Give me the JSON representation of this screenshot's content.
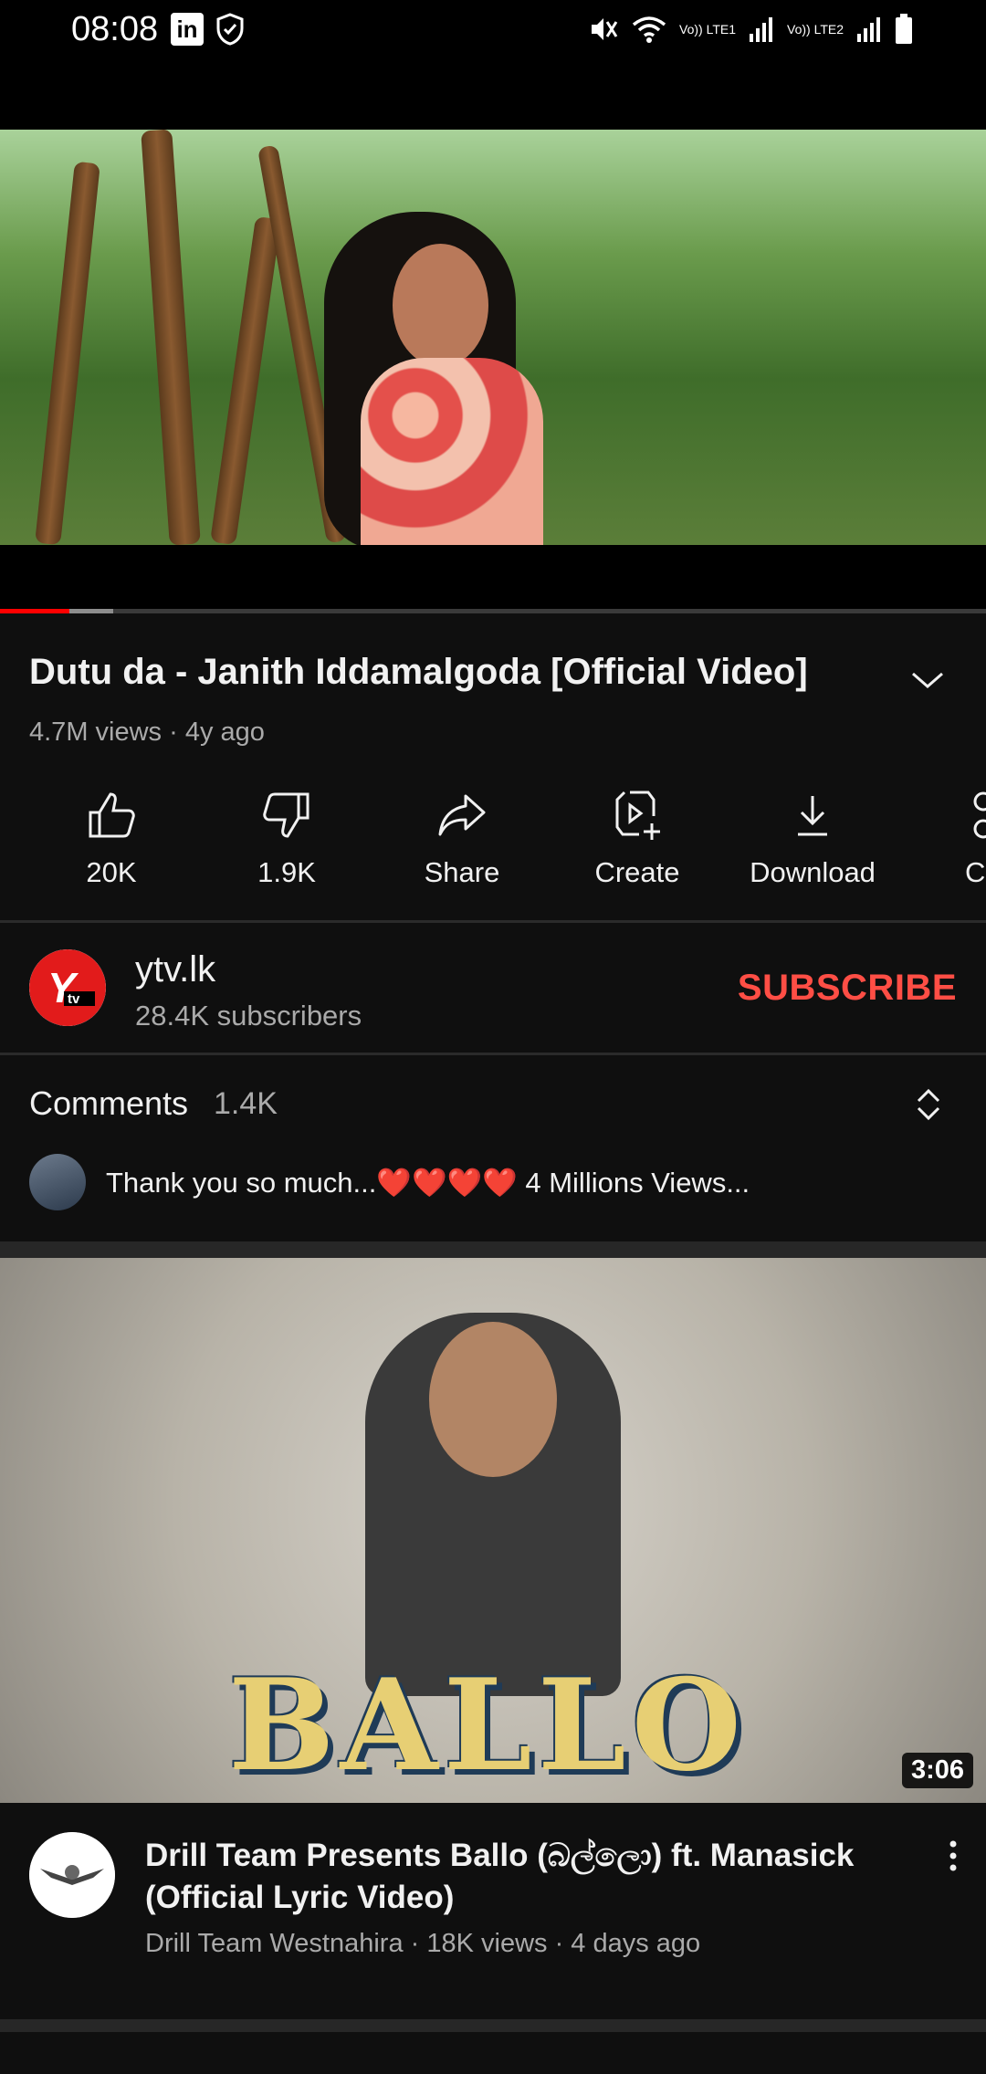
{
  "status_bar": {
    "time": "08:08",
    "left_icons": [
      "linkedin-icon",
      "shield-icon"
    ],
    "right_icons": [
      "mute-icon",
      "wifi-icon",
      "signal-icon",
      "battery-icon"
    ],
    "sim1": "Vo)) LTE1",
    "sim2": "Vo)) LTE2"
  },
  "player": {
    "progress_played": 0.07,
    "progress_buffered": 0.115
  },
  "video": {
    "title": "Dutu da - Janith Iddamalgoda [Official Video]",
    "meta": "4.7M views · 4y ago"
  },
  "actions": [
    {
      "label": "20K",
      "icon": "like-icon"
    },
    {
      "label": "1.9K",
      "icon": "dislike-icon"
    },
    {
      "label": "Share",
      "icon": "share-icon"
    },
    {
      "label": "Create",
      "icon": "create-icon"
    },
    {
      "label": "Download",
      "icon": "download-icon"
    },
    {
      "label": "Cl",
      "icon": "clip-icon"
    }
  ],
  "channel": {
    "name": "ytv.lk",
    "subscribers": "28.4K subscribers",
    "subscribe_label": "SUBSCRIBE",
    "avatar_text": "Ytv"
  },
  "comments": {
    "title": "Comments",
    "count": "1.4K",
    "top_comment": "Thank you so much...❤️❤️❤️❤️ 4 Millions Views..."
  },
  "recommended": {
    "thumb_text": "BALLO",
    "duration": "3:06",
    "title": "Drill Team Presents Ballo (බල්ලො) ft. Manasick (Official Lyric Video)",
    "meta": "Drill Team Westnahira · 18K views · 4 days ago"
  },
  "colors": {
    "background": "#0f0f0f",
    "accent": "#ff0000",
    "subscribe": "#ff4e45",
    "secondary_text": "#aaaaaa"
  }
}
